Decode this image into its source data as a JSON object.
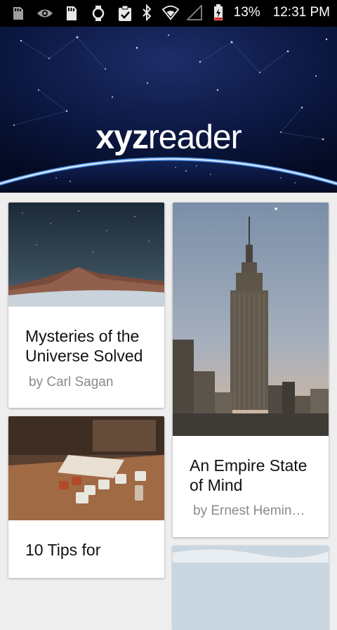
{
  "status_bar": {
    "battery_percent": "13%",
    "time": "12:31 PM",
    "icons_left": [
      "sd-card-icon",
      "eye-icon",
      "sd-card-icon",
      "watch-icon",
      "clipboard-check-icon"
    ],
    "icons_right": [
      "bluetooth-icon",
      "wifi-icon",
      "signal-icon",
      "battery-charging-icon"
    ]
  },
  "header": {
    "logo_bold": "xyz",
    "logo_regular": "reader"
  },
  "articles": [
    {
      "title": "Mysteries of the Universe Solved",
      "author": "by Carl Sagan",
      "thumbnail": "night-sky-mountains"
    },
    {
      "title": "An Empire State of Mind",
      "author": "by Ernest Hemin…",
      "thumbnail": "empire-state-building"
    },
    {
      "title": "10 Tips for",
      "author": "",
      "thumbnail": "coffee-cups-table"
    },
    {
      "title": "",
      "author": "",
      "thumbnail": "cloudy-sky"
    }
  ],
  "colors": {
    "status_bar": "#000000",
    "background": "#eeeeee",
    "card": "#ffffff",
    "author_text": "#8a8a8a",
    "header_sky": "#0a1840"
  }
}
